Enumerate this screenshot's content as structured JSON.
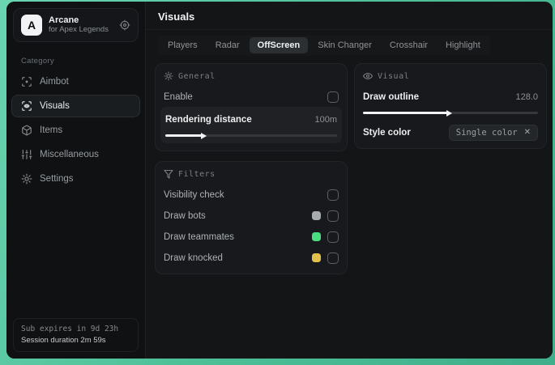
{
  "colors": {
    "desktop_teal": "#4cbf97",
    "accent_white": "#f2f3f4",
    "swatch_bots": "#a8abad",
    "swatch_teammates": "#4ade80",
    "swatch_knocked": "#e3c04c"
  },
  "sidebar": {
    "app": {
      "logo_letter": "A",
      "name": "Arcane",
      "subtitle": "for Apex Legends"
    },
    "category_label": "Category",
    "items": [
      {
        "label": "Aimbot"
      },
      {
        "label": "Visuals"
      },
      {
        "label": "Items"
      },
      {
        "label": "Miscellaneous"
      },
      {
        "label": "Settings"
      }
    ],
    "footer": {
      "line1": "Sub expires in 9d 23h",
      "line2": "Session duration 2m 59s"
    }
  },
  "main": {
    "title": "Visuals",
    "tabs": [
      {
        "label": "Players"
      },
      {
        "label": "Radar"
      },
      {
        "label": "OffScreen"
      },
      {
        "label": "Skin Changer"
      },
      {
        "label": "Crosshair"
      },
      {
        "label": "Highlight"
      }
    ],
    "panels": {
      "general": {
        "title": "General",
        "enable_label": "Enable",
        "distance_label": "Rendering distance",
        "distance_value": "100m",
        "distance_fill_percent": 21
      },
      "filters": {
        "title": "Filters",
        "rows": [
          {
            "label": "Visibility check"
          },
          {
            "label": "Draw bots",
            "swatch": "#a8abad"
          },
          {
            "label": "Draw teammates",
            "swatch": "#4ade80"
          },
          {
            "label": "Draw knocked",
            "swatch": "#e3c04c"
          }
        ]
      },
      "visual": {
        "title": "Visual",
        "outline_label": "Draw outline",
        "outline_value": "128.0",
        "outline_fill_percent": 48,
        "style_label": "Style color",
        "style_value": "Single color",
        "style_clear": "✕"
      }
    }
  }
}
